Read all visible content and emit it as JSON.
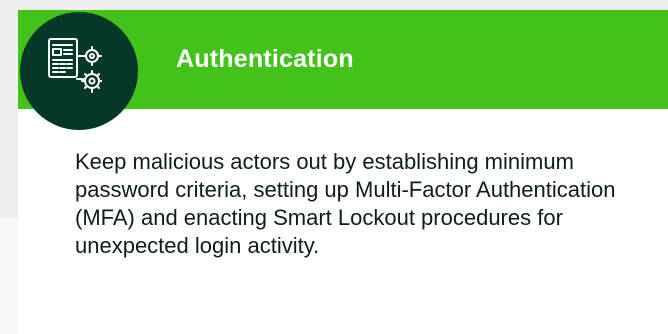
{
  "card": {
    "title": "Authentication",
    "description": "Keep malicious actors out by establishing minimum password criteria, setting up Multi-Factor Authentication (MFA) and enacting Smart Lockout procedures for unexpected login activity.",
    "icon": "authentication-settings-icon"
  },
  "colors": {
    "header_green": "#43c21c",
    "badge_dark_green": "#06382a",
    "body_text": "#0d1f17",
    "card_background": "#ffffff"
  }
}
